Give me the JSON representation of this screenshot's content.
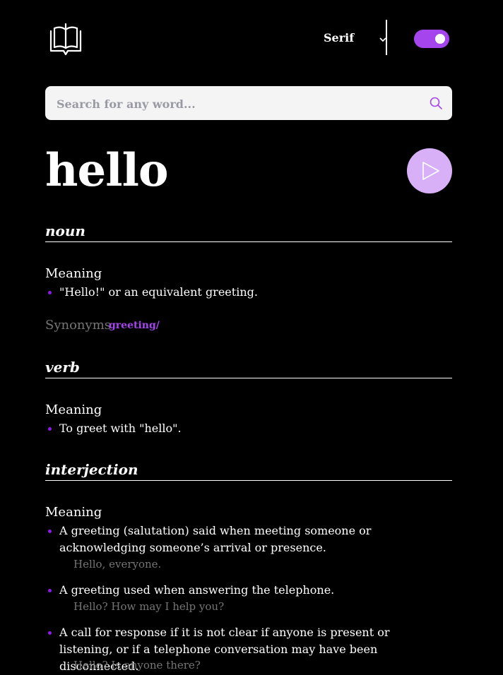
{
  "header": {
    "font_select_value": "Serif",
    "accent_color": "#a445ed"
  },
  "search": {
    "placeholder": "Search for any word..."
  },
  "word": {
    "title": "hello"
  },
  "sections": [
    {
      "part_of_speech": "noun",
      "meaning_label": "Meaning",
      "definitions": [
        {
          "text": "\"Hello!\" or an equivalent greeting."
        }
      ],
      "synonyms_label": "Synonyms",
      "synonyms": [
        "greeting/"
      ]
    },
    {
      "part_of_speech": "verb",
      "meaning_label": "Meaning",
      "definitions": [
        {
          "text": "To greet with \"hello\"."
        }
      ]
    },
    {
      "part_of_speech": "interjection",
      "meaning_label": "Meaning",
      "definitions": [
        {
          "text": "A greeting (salutation) said when meeting someone or acknowledging someone’s arrival or presence.",
          "example": "Hello, everyone."
        },
        {
          "text": "A greeting used when answering the telephone.",
          "example": "Hello? How may I help you?"
        },
        {
          "text": "A call for response if it is not clear if anyone is present or listening, or if a telephone conversation may have been disconnected.",
          "example": "Hello? Is anyone there?"
        }
      ]
    }
  ],
  "icons": {
    "logo": "book-icon",
    "search": "search-icon",
    "play": "play-icon",
    "chevron": "chevron-down-icon"
  }
}
